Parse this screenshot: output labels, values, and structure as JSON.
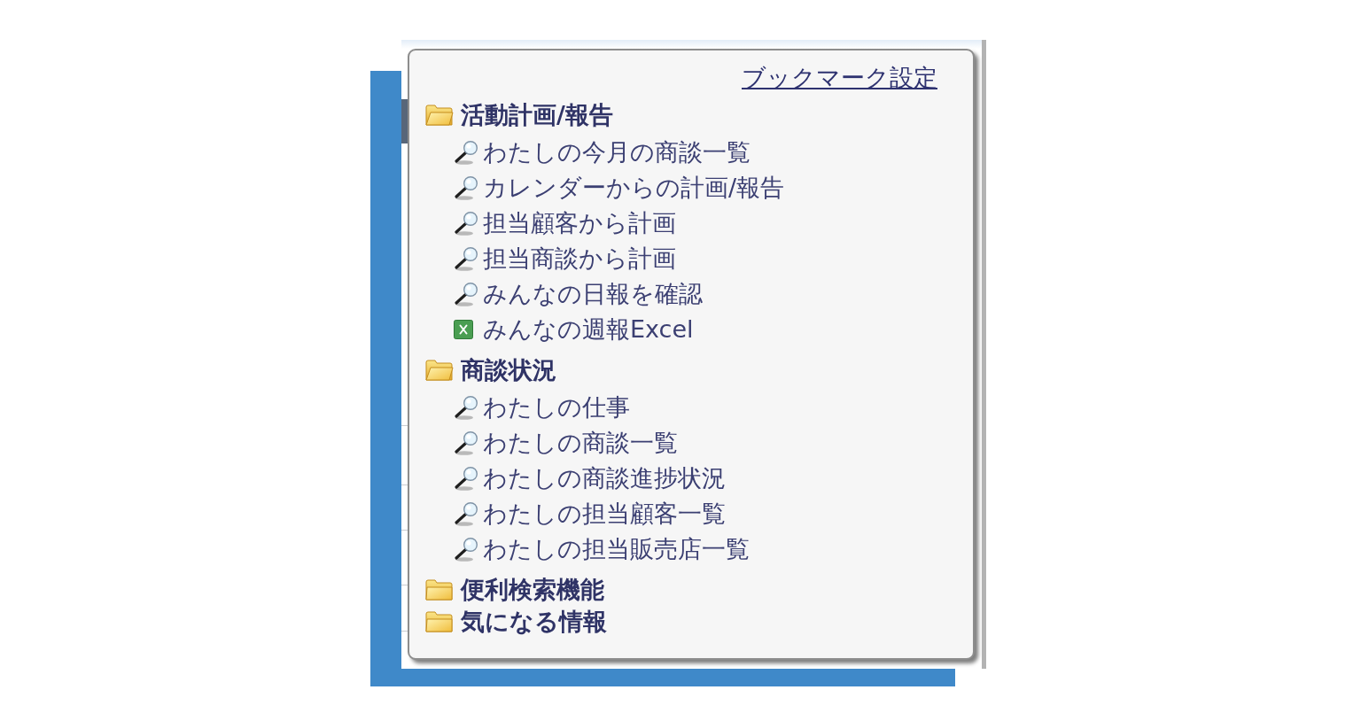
{
  "bookmark_menu": {
    "settings_link": "ブックマーク設定",
    "folders": [
      {
        "label": "活動計画/報告",
        "expanded": true,
        "items": [
          {
            "label": "わたしの今月の商談一覧",
            "kind": "search"
          },
          {
            "label": "カレンダーからの計画/報告",
            "kind": "search"
          },
          {
            "label": "担当顧客から計画",
            "kind": "search"
          },
          {
            "label": "担当商談から計画",
            "kind": "search"
          },
          {
            "label": "みんなの日報を確認",
            "kind": "search"
          },
          {
            "label": "みんなの週報Excel",
            "kind": "excel"
          }
        ]
      },
      {
        "label": "商談状況",
        "expanded": true,
        "items": [
          {
            "label": "わたしの仕事",
            "kind": "search"
          },
          {
            "label": "わたしの商談一覧",
            "kind": "search"
          },
          {
            "label": "わたしの商談進捗状況",
            "kind": "search"
          },
          {
            "label": "わたしの担当顧客一覧",
            "kind": "search"
          },
          {
            "label": "わたしの担当販売店一覧",
            "kind": "search"
          }
        ]
      },
      {
        "label": "便利検索機能",
        "expanded": false
      },
      {
        "label": "気になる情報",
        "expanded": false
      }
    ]
  }
}
